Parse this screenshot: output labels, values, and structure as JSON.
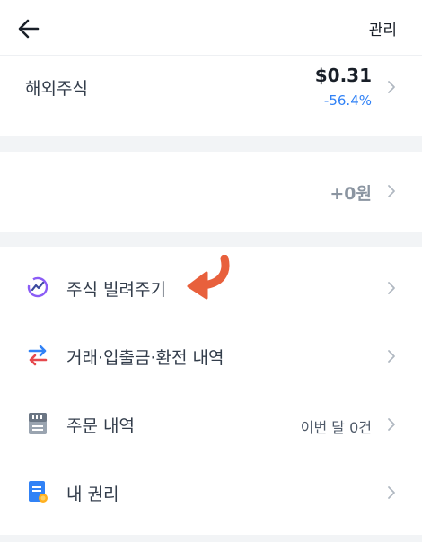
{
  "header": {
    "manage_label": "관리"
  },
  "overseas": {
    "label": "해외주식",
    "amount": "$0.31",
    "change": "-56.4%"
  },
  "krw": {
    "value": "+0원"
  },
  "menu": [
    {
      "label": "주식 빌려주기",
      "value": ""
    },
    {
      "label": "거래·입출금·환전 내역",
      "value": ""
    },
    {
      "label": "주문 내역",
      "value": "이번 달 0건"
    },
    {
      "label": "내 권리",
      "value": ""
    }
  ],
  "icons": {
    "back": "arrow-left-icon",
    "chevron": "chevron-right-icon",
    "lending": "lending-chart-icon",
    "transfer": "swap-arrows-icon",
    "orders": "receipt-icon",
    "rights": "certificate-icon"
  },
  "colors": {
    "positive_blue": "#3182f6",
    "annotation_arrow": "#e8603c",
    "lending_purple": "#8b5cf6",
    "gray_text": "#8b95a1",
    "section_bg": "#f2f4f6"
  }
}
